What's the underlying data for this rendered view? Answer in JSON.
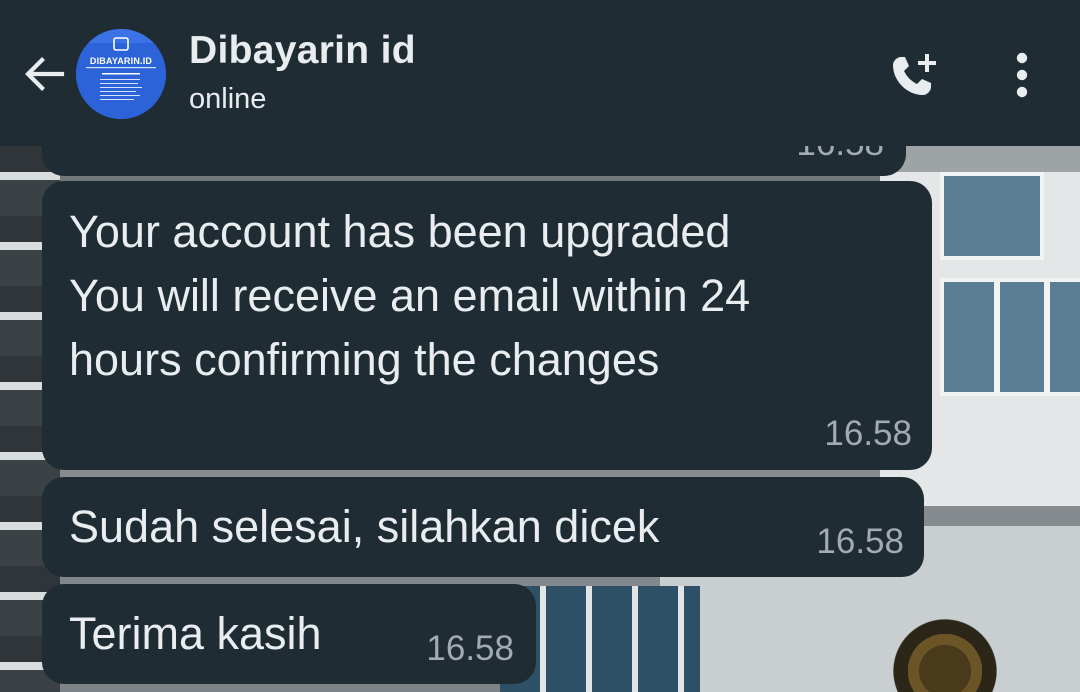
{
  "header": {
    "back_icon": "arrow-back-icon",
    "avatar_text": "DIBAYARIN.ID",
    "contact_name": "Dibayarin id",
    "contact_status": "online",
    "call_icon": "add-call-icon",
    "menu_icon": "more-vert-icon"
  },
  "messages": [
    {
      "lines": [
        "Your account has been upgraded",
        "You will receive an email within 24",
        "hours confirming the changes"
      ],
      "time": "16.58"
    },
    {
      "lines": [
        "Sudah selesai, silahkan dicek"
      ],
      "time": "16.58"
    },
    {
      "lines": [
        "Terima kasih"
      ],
      "time": "16.58"
    }
  ],
  "colors": {
    "header_bg": "#1f2c34",
    "bubble_bg": "#1f2c34",
    "text": "#e9edef",
    "timestamp": "#a2abb0",
    "avatar_bg": "#2e63d6"
  }
}
